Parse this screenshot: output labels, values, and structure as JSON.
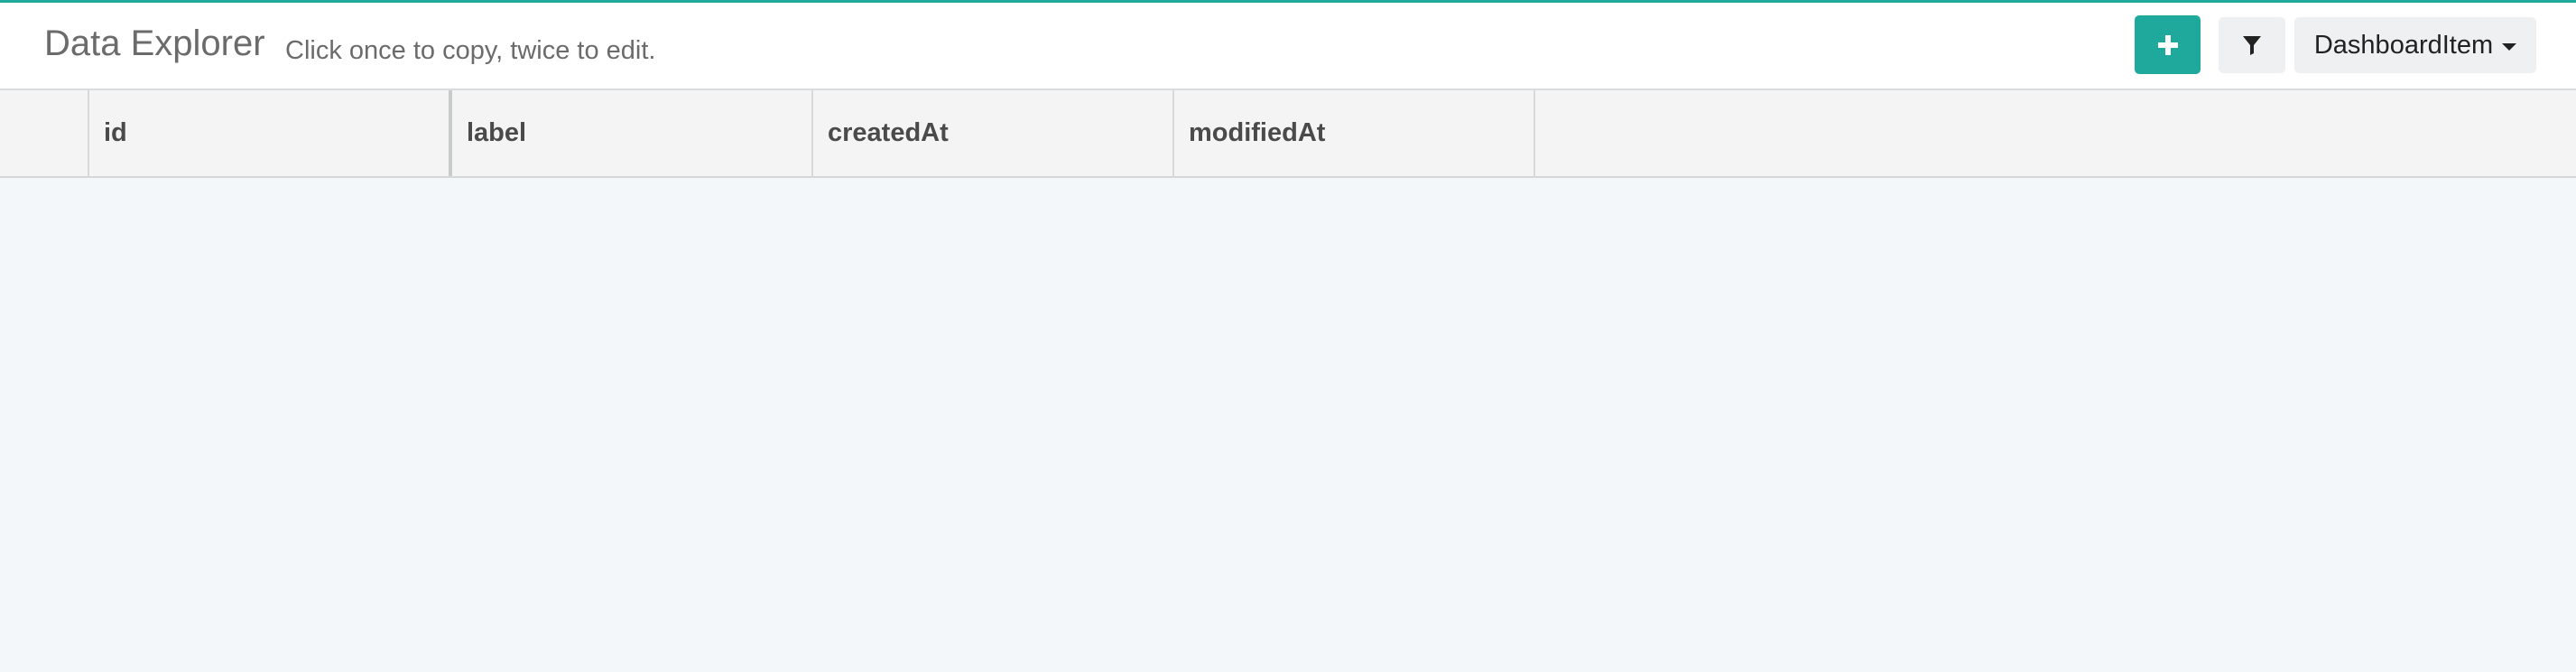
{
  "header": {
    "title": "Data Explorer",
    "subtitle": "Click once to copy, twice to edit.",
    "add_icon": "plus-icon",
    "filter_icon": "filter-icon",
    "dropdown_value": "DashboardItem",
    "accent_color": "#1fa99c"
  },
  "grid": {
    "columns": [
      "id",
      "label",
      "createdAt",
      "modifiedAt"
    ],
    "rows": []
  }
}
